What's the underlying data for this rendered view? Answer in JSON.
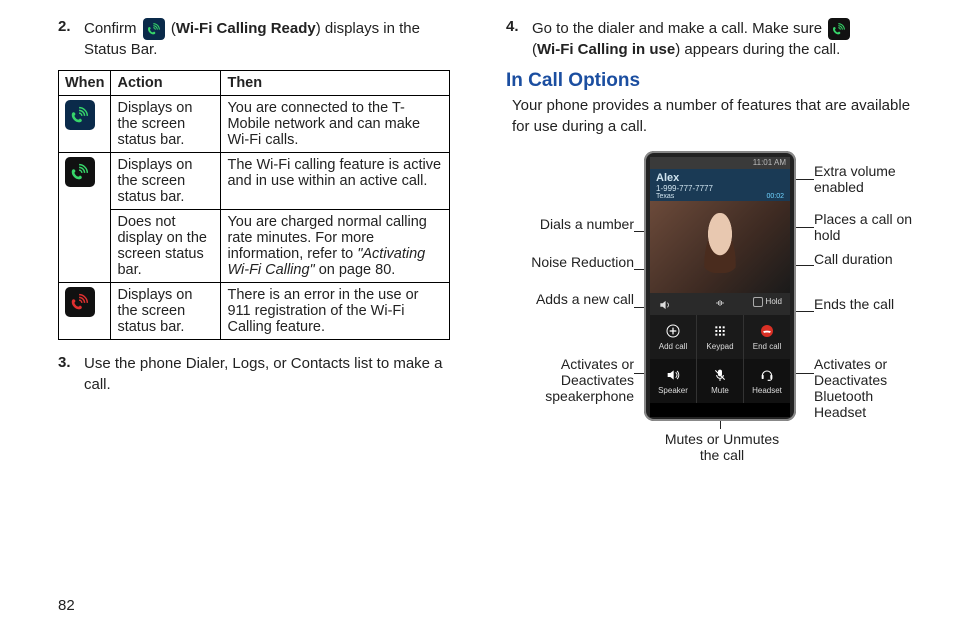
{
  "page_number": "82",
  "left": {
    "step2": {
      "num": "2.",
      "pre": "Confirm",
      "paren_open": "(",
      "bold": "Wi-Fi Calling Ready",
      "paren_close": ")",
      "post": " displays in the Status Bar."
    },
    "table": {
      "head": {
        "when": "When",
        "action": "Action",
        "then": "Then"
      },
      "rows": [
        {
          "icon": "blue-green",
          "action": "Displays on the screen status bar.",
          "then": "You are connected to the T-Mobile network and can make Wi-Fi calls."
        },
        {
          "icon": "black-green",
          "action": "Displays on the screen status bar.",
          "then": "The Wi-Fi calling feature is active and in use within an active call."
        },
        {
          "icon": "",
          "action": "Does not display on the screen status bar.",
          "then_pre": "You are charged normal calling rate minutes. For more information, refer to ",
          "then_italic": "\"Activating Wi-Fi Calling\"",
          "then_post": " on page 80."
        },
        {
          "icon": "black-red",
          "action": "Displays on the screen status bar.",
          "then": "There is an error in the use or 911 registration of the Wi-Fi Calling feature."
        }
      ]
    },
    "step3": {
      "num": "3.",
      "text": "Use the phone Dialer, Logs, or Contacts list to make a call."
    }
  },
  "right": {
    "step4": {
      "num": "4.",
      "pre": "Go to the dialer and make a call. Make sure",
      "paren_open": "(",
      "bold": "Wi-Fi Calling in use",
      "paren_close": ")",
      "post": " appears during the call."
    },
    "section_title": "In Call Options",
    "section_desc": "Your phone provides a number of features that are available for use during a call.",
    "phone": {
      "status_time": "11:01 AM",
      "caller": "Alex",
      "number": "1-999-777-7777",
      "state": "Texas",
      "timer": "00:02",
      "hold": "Hold",
      "btn_addcall": "Add call",
      "btn_keypad": "Keypad",
      "btn_endcall": "End call",
      "btn_speaker": "Speaker",
      "btn_mute": "Mute",
      "btn_headset": "Headset"
    },
    "labels": {
      "dials": "Dials a number",
      "noise": "Noise Reduction",
      "adds": "Adds a new call",
      "speaker": "Activates or Deactivates speakerphone",
      "mute": "Mutes or Unmutes the call",
      "extra_vol": "Extra volume enabled",
      "hold": "Places a call on hold",
      "duration": "Call duration",
      "end": "Ends the call",
      "headset": "Activates or Deactivates Bluetooth Headset"
    }
  }
}
